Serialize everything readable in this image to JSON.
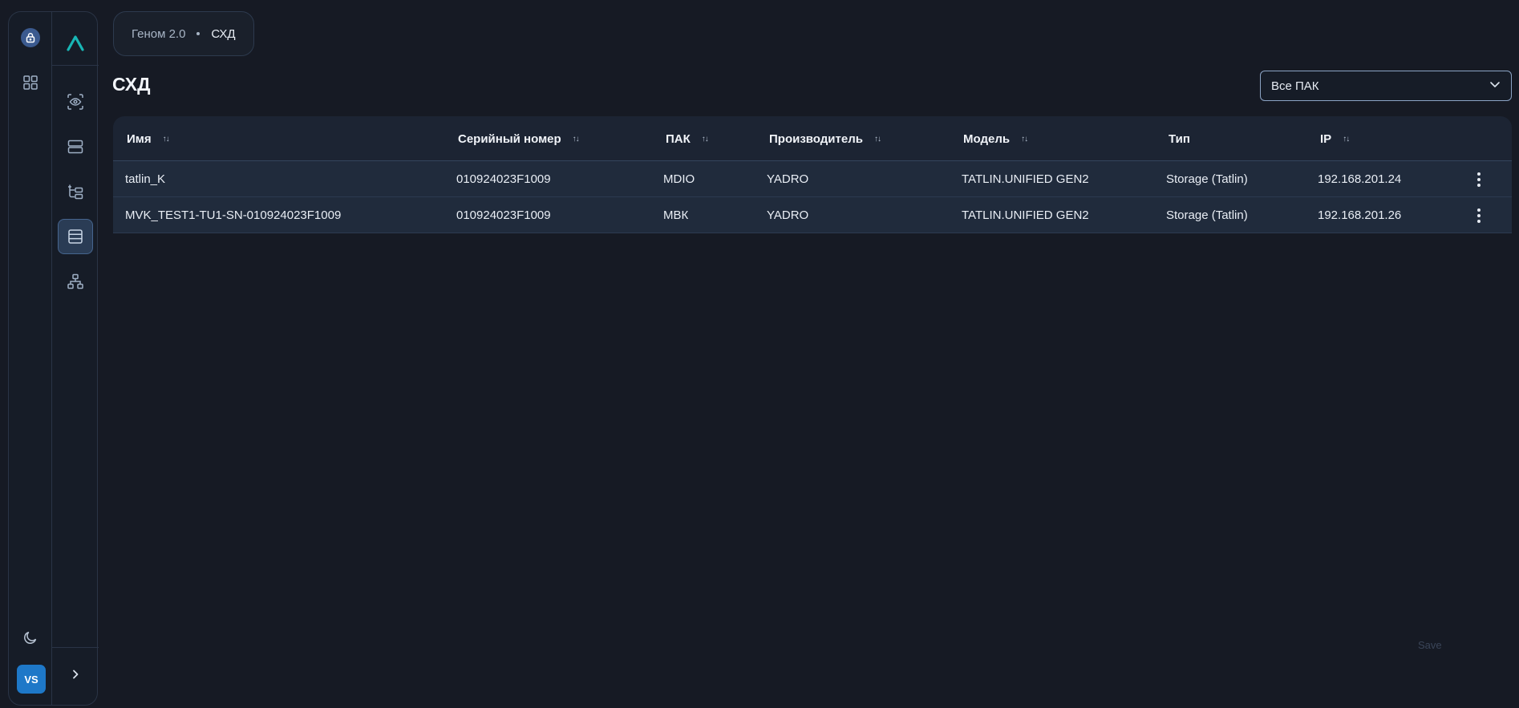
{
  "breadcrumb": {
    "root": "Геном 2.0",
    "current": "СХД"
  },
  "page": {
    "title": "СХД"
  },
  "filter": {
    "selected": "Все ПАК"
  },
  "user": {
    "initials": "VS"
  },
  "table": {
    "columns": [
      "Имя",
      "Серийный номер",
      "ПАК",
      "Производитель",
      "Модель",
      "Тип",
      "IP"
    ],
    "rows": [
      [
        "tatlin_K",
        "010924023F1009",
        "MDIO",
        "YADRO",
        "TATLIN.UNIFIED GEN2",
        "Storage (Tatlin)",
        "192.168.201.24"
      ],
      [
        "MVK_TEST1-TU1-SN-010924023F1009",
        "010924023F1009",
        "МВК",
        "YADRO",
        "TATLIN.UNIFIED GEN2",
        "Storage (Tatlin)",
        "192.168.201.26"
      ]
    ]
  },
  "footer": {
    "save_label": "Save"
  },
  "icons": {
    "rail": [
      "lock-icon",
      "grid-icon",
      "moon-icon"
    ],
    "nav": [
      "eye-scan-icon",
      "server-icon",
      "tree-icon",
      "storage-icon",
      "network-icon",
      "chevron-right-icon"
    ]
  },
  "colors": {
    "accent": "#18b6b5",
    "avatar": "#1e78c8",
    "background": "#161a24"
  }
}
